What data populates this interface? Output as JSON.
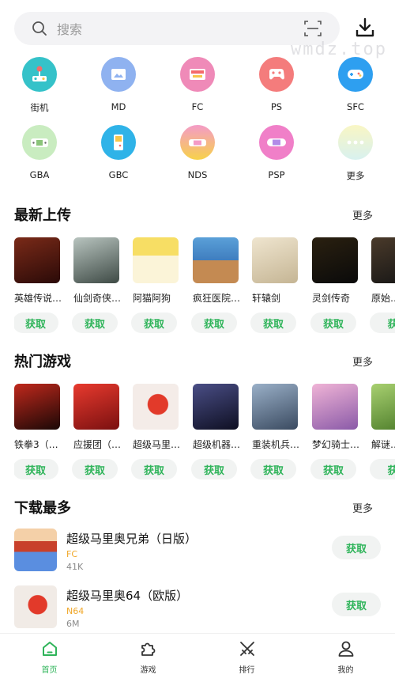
{
  "search": {
    "placeholder": "搜索"
  },
  "watermark": "wmdz.top",
  "categories": [
    {
      "label": "街机",
      "icon": "arcade-joystick-icon",
      "color": "#35c2c9"
    },
    {
      "label": "MD",
      "icon": "md-console-icon",
      "color": "#8fb2f0"
    },
    {
      "label": "FC",
      "icon": "fc-console-icon",
      "color": "#ef8ab8"
    },
    {
      "label": "PS",
      "icon": "ps-gamepad-icon",
      "color": "#f47c7c"
    },
    {
      "label": "SFC",
      "icon": "sfc-gamepad-icon",
      "color": "#2e9ff0"
    },
    {
      "label": "GBA",
      "icon": "gba-handheld-icon",
      "color": "#c9ecc0"
    },
    {
      "label": "GBC",
      "icon": "gbc-handheld-icon",
      "color": "#2fb3e8"
    },
    {
      "label": "NDS",
      "icon": "nds-handheld-icon",
      "color": "#f7c54a"
    },
    {
      "label": "PSP",
      "icon": "psp-handheld-icon",
      "color": "#f07fc8"
    },
    {
      "label": "更多",
      "icon": "more-dots-icon",
      "color": "#f4f2c7"
    }
  ],
  "sections": {
    "latest": {
      "title": "最新上传",
      "more": "更多"
    },
    "hot": {
      "title": "热门游戏",
      "more": "更多"
    },
    "top": {
      "title": "下载最多",
      "more": "更多"
    }
  },
  "latest": [
    {
      "name": "英雄传说…",
      "get": "获取",
      "thumb": "#5a1a14"
    },
    {
      "name": "仙剑奇侠…",
      "get": "获取",
      "thumb": "#7b8a84"
    },
    {
      "name": "阿猫阿狗",
      "get": "获取",
      "thumb": "#f0d55a"
    },
    {
      "name": "疯狂医院…",
      "get": "获取",
      "thumb": "#3f7dbf"
    },
    {
      "name": "轩辕剑",
      "get": "获取",
      "thumb": "#d8cbb0"
    },
    {
      "name": "灵剑传奇",
      "get": "获取",
      "thumb": "#141414"
    },
    {
      "name": "原始…",
      "get": "获",
      "thumb": "#2a2a2a"
    }
  ],
  "hot": [
    {
      "name": "铁拳3（…",
      "get": "获取",
      "thumb": "#2a0c08"
    },
    {
      "name": "应援团（…",
      "get": "获取",
      "thumb": "#c8282a"
    },
    {
      "name": "超级马里…",
      "get": "获取",
      "thumb": "#e9e1e0"
    },
    {
      "name": "超级机器…",
      "get": "获取",
      "thumb": "#1c1e3a"
    },
    {
      "name": "重装机兵…",
      "get": "获取",
      "thumb": "#59708c"
    },
    {
      "name": "梦幻骑士…",
      "get": "获取",
      "thumb": "#c58cc0"
    },
    {
      "name": "解谜…",
      "get": "获",
      "thumb": "#6e9a3c"
    }
  ],
  "top": [
    {
      "title": "超级马里奥兄弟（日版）",
      "platform": "FC",
      "size": "41K",
      "get": "获取",
      "thumb": "#f3c4a0"
    },
    {
      "title": "超级马里奥64（欧版）",
      "platform": "N64",
      "size": "6M",
      "get": "获取",
      "thumb": "#e6e0dc"
    }
  ],
  "tabs": [
    {
      "label": "首页",
      "icon": "home-icon",
      "active": true
    },
    {
      "label": "游戏",
      "icon": "puzzle-icon",
      "active": false
    },
    {
      "label": "排行",
      "icon": "crossed-swords-icon",
      "active": false
    },
    {
      "label": "我的",
      "icon": "profile-icon",
      "active": false
    }
  ],
  "colors": {
    "accent": "#2fb45a",
    "platform_tag": "#f0a728"
  }
}
